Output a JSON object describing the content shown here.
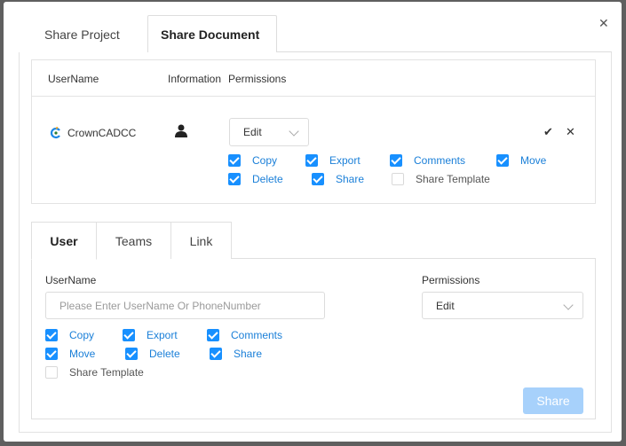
{
  "dialog": {
    "close_icon": "close-icon"
  },
  "top_tabs": [
    {
      "label": "Share Project",
      "active": false
    },
    {
      "label": "Share Document",
      "active": true
    }
  ],
  "members": {
    "headers": {
      "username": "UserName",
      "information": "Information",
      "permissions": "Permissions"
    },
    "row": {
      "username": "CrownCADCC",
      "permission": "Edit",
      "options": [
        {
          "label": "Copy",
          "checked": true
        },
        {
          "label": "Export",
          "checked": true
        },
        {
          "label": "Comments",
          "checked": true
        },
        {
          "label": "Move",
          "checked": true
        },
        {
          "label": "Delete",
          "checked": true
        },
        {
          "label": "Share",
          "checked": true
        },
        {
          "label": "Share Template",
          "checked": false
        }
      ]
    }
  },
  "bottom_tabs": [
    {
      "label": "User",
      "active": true
    },
    {
      "label": "Teams",
      "active": false
    },
    {
      "label": "Link",
      "active": false
    }
  ],
  "invite": {
    "username_label": "UserName",
    "username_placeholder": "Please Enter UserName Or PhoneNumber",
    "username_value": "",
    "permissions_label": "Permissions",
    "permission": "Edit",
    "options": [
      {
        "label": "Copy",
        "checked": true
      },
      {
        "label": "Export",
        "checked": true
      },
      {
        "label": "Comments",
        "checked": true
      },
      {
        "label": "Move",
        "checked": true
      },
      {
        "label": "Delete",
        "checked": true
      },
      {
        "label": "Share",
        "checked": true
      },
      {
        "label": "Share Template",
        "checked": false
      }
    ],
    "share_button": "Share"
  },
  "colors": {
    "accent": "#1890ff",
    "link": "#1a7fd8",
    "disabled_button": "#a7d1fb"
  }
}
